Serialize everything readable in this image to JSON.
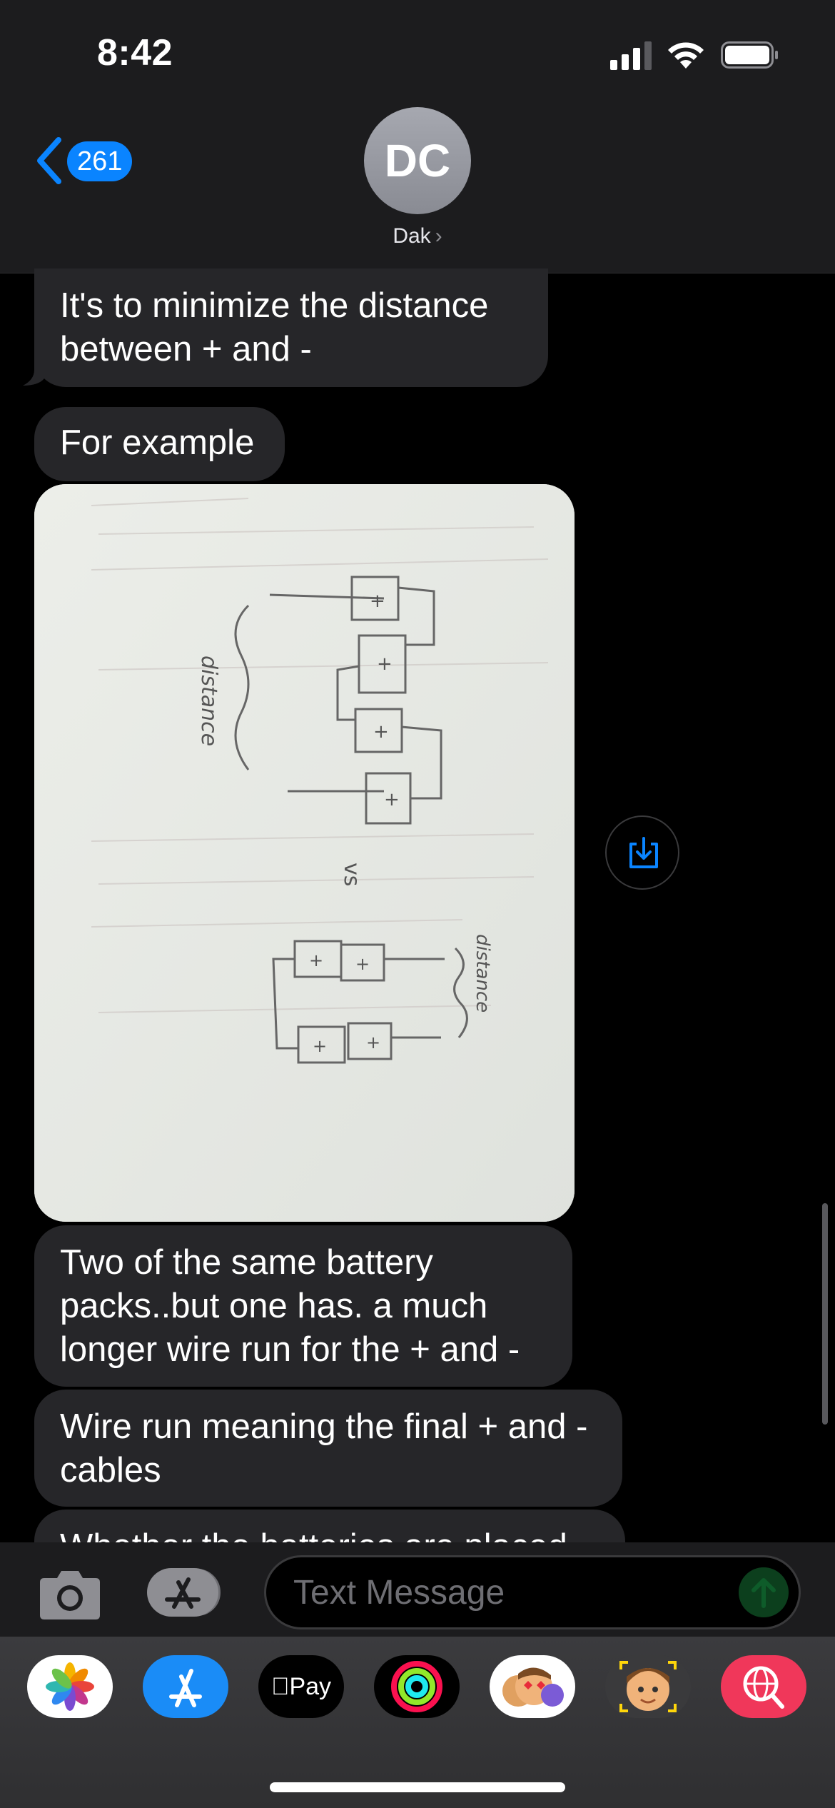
{
  "status_bar": {
    "time": "8:42"
  },
  "header": {
    "back_count": "261",
    "avatar_initials": "DC",
    "contact_name": "Dak",
    "contact_chevron": "›"
  },
  "messages": [
    {
      "text": "It's to minimize the distance between + and -"
    },
    {
      "text": "For example"
    },
    {
      "text": "Two of the same battery packs..but one has. a much longer wire run for the + and -"
    },
    {
      "text": "Wire run meaning the final + and - cables"
    },
    {
      "text": "Whether the batteries are placed"
    }
  ],
  "photo": {
    "sketch_label_left": "distance",
    "sketch_label_mid": "vs",
    "sketch_label_right": "distance"
  },
  "input": {
    "placeholder": "Text Message"
  },
  "drawer": {
    "apps": [
      {
        "name": "photos-app-icon"
      },
      {
        "name": "app-store-icon"
      },
      {
        "name": "apple-pay-icon",
        "label": "Pay"
      },
      {
        "name": "fitness-icon"
      },
      {
        "name": "memoji-stickers-icon"
      },
      {
        "name": "memoji-icon"
      },
      {
        "name": "web-search-icon"
      }
    ]
  },
  "colors": {
    "accent": "#0a84ff",
    "bubble": "#262629",
    "header": "#1c1c1e"
  }
}
